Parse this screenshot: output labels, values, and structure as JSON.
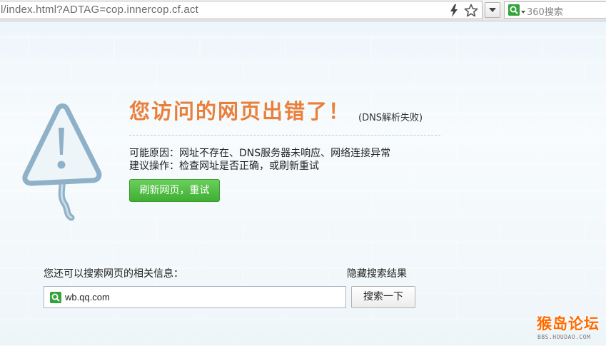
{
  "browser": {
    "address_url": "l/index.html?ADTAG=cop.innercop.cf.act",
    "search_placeholder": "360搜索",
    "icons": {
      "bolt": "bolt-icon",
      "star": "star-icon",
      "dropdown": "chevron-down-icon",
      "search_engine": "search-engine-icon"
    }
  },
  "error": {
    "title": "您访问的网页出错了！",
    "subtitle": "(DNS解析失败)",
    "reason": "可能原因：网址不存在、DNS服务器未响应、网络连接异常",
    "suggestion": "建议操作：检查网址是否正确，或刷新重试",
    "refresh_label": "刷新网页，重试",
    "colors": {
      "title": "#e8803c",
      "button": "#4cbb3f"
    }
  },
  "search": {
    "prompt": "您还可以搜索网页的相关信息：",
    "hide_label": "隐藏搜索结果",
    "input_value": "wb.qq.com",
    "button_label": "搜索一下"
  },
  "watermark": {
    "main": "猴岛论坛",
    "sub": "BBS.HOUDAO.COM"
  }
}
